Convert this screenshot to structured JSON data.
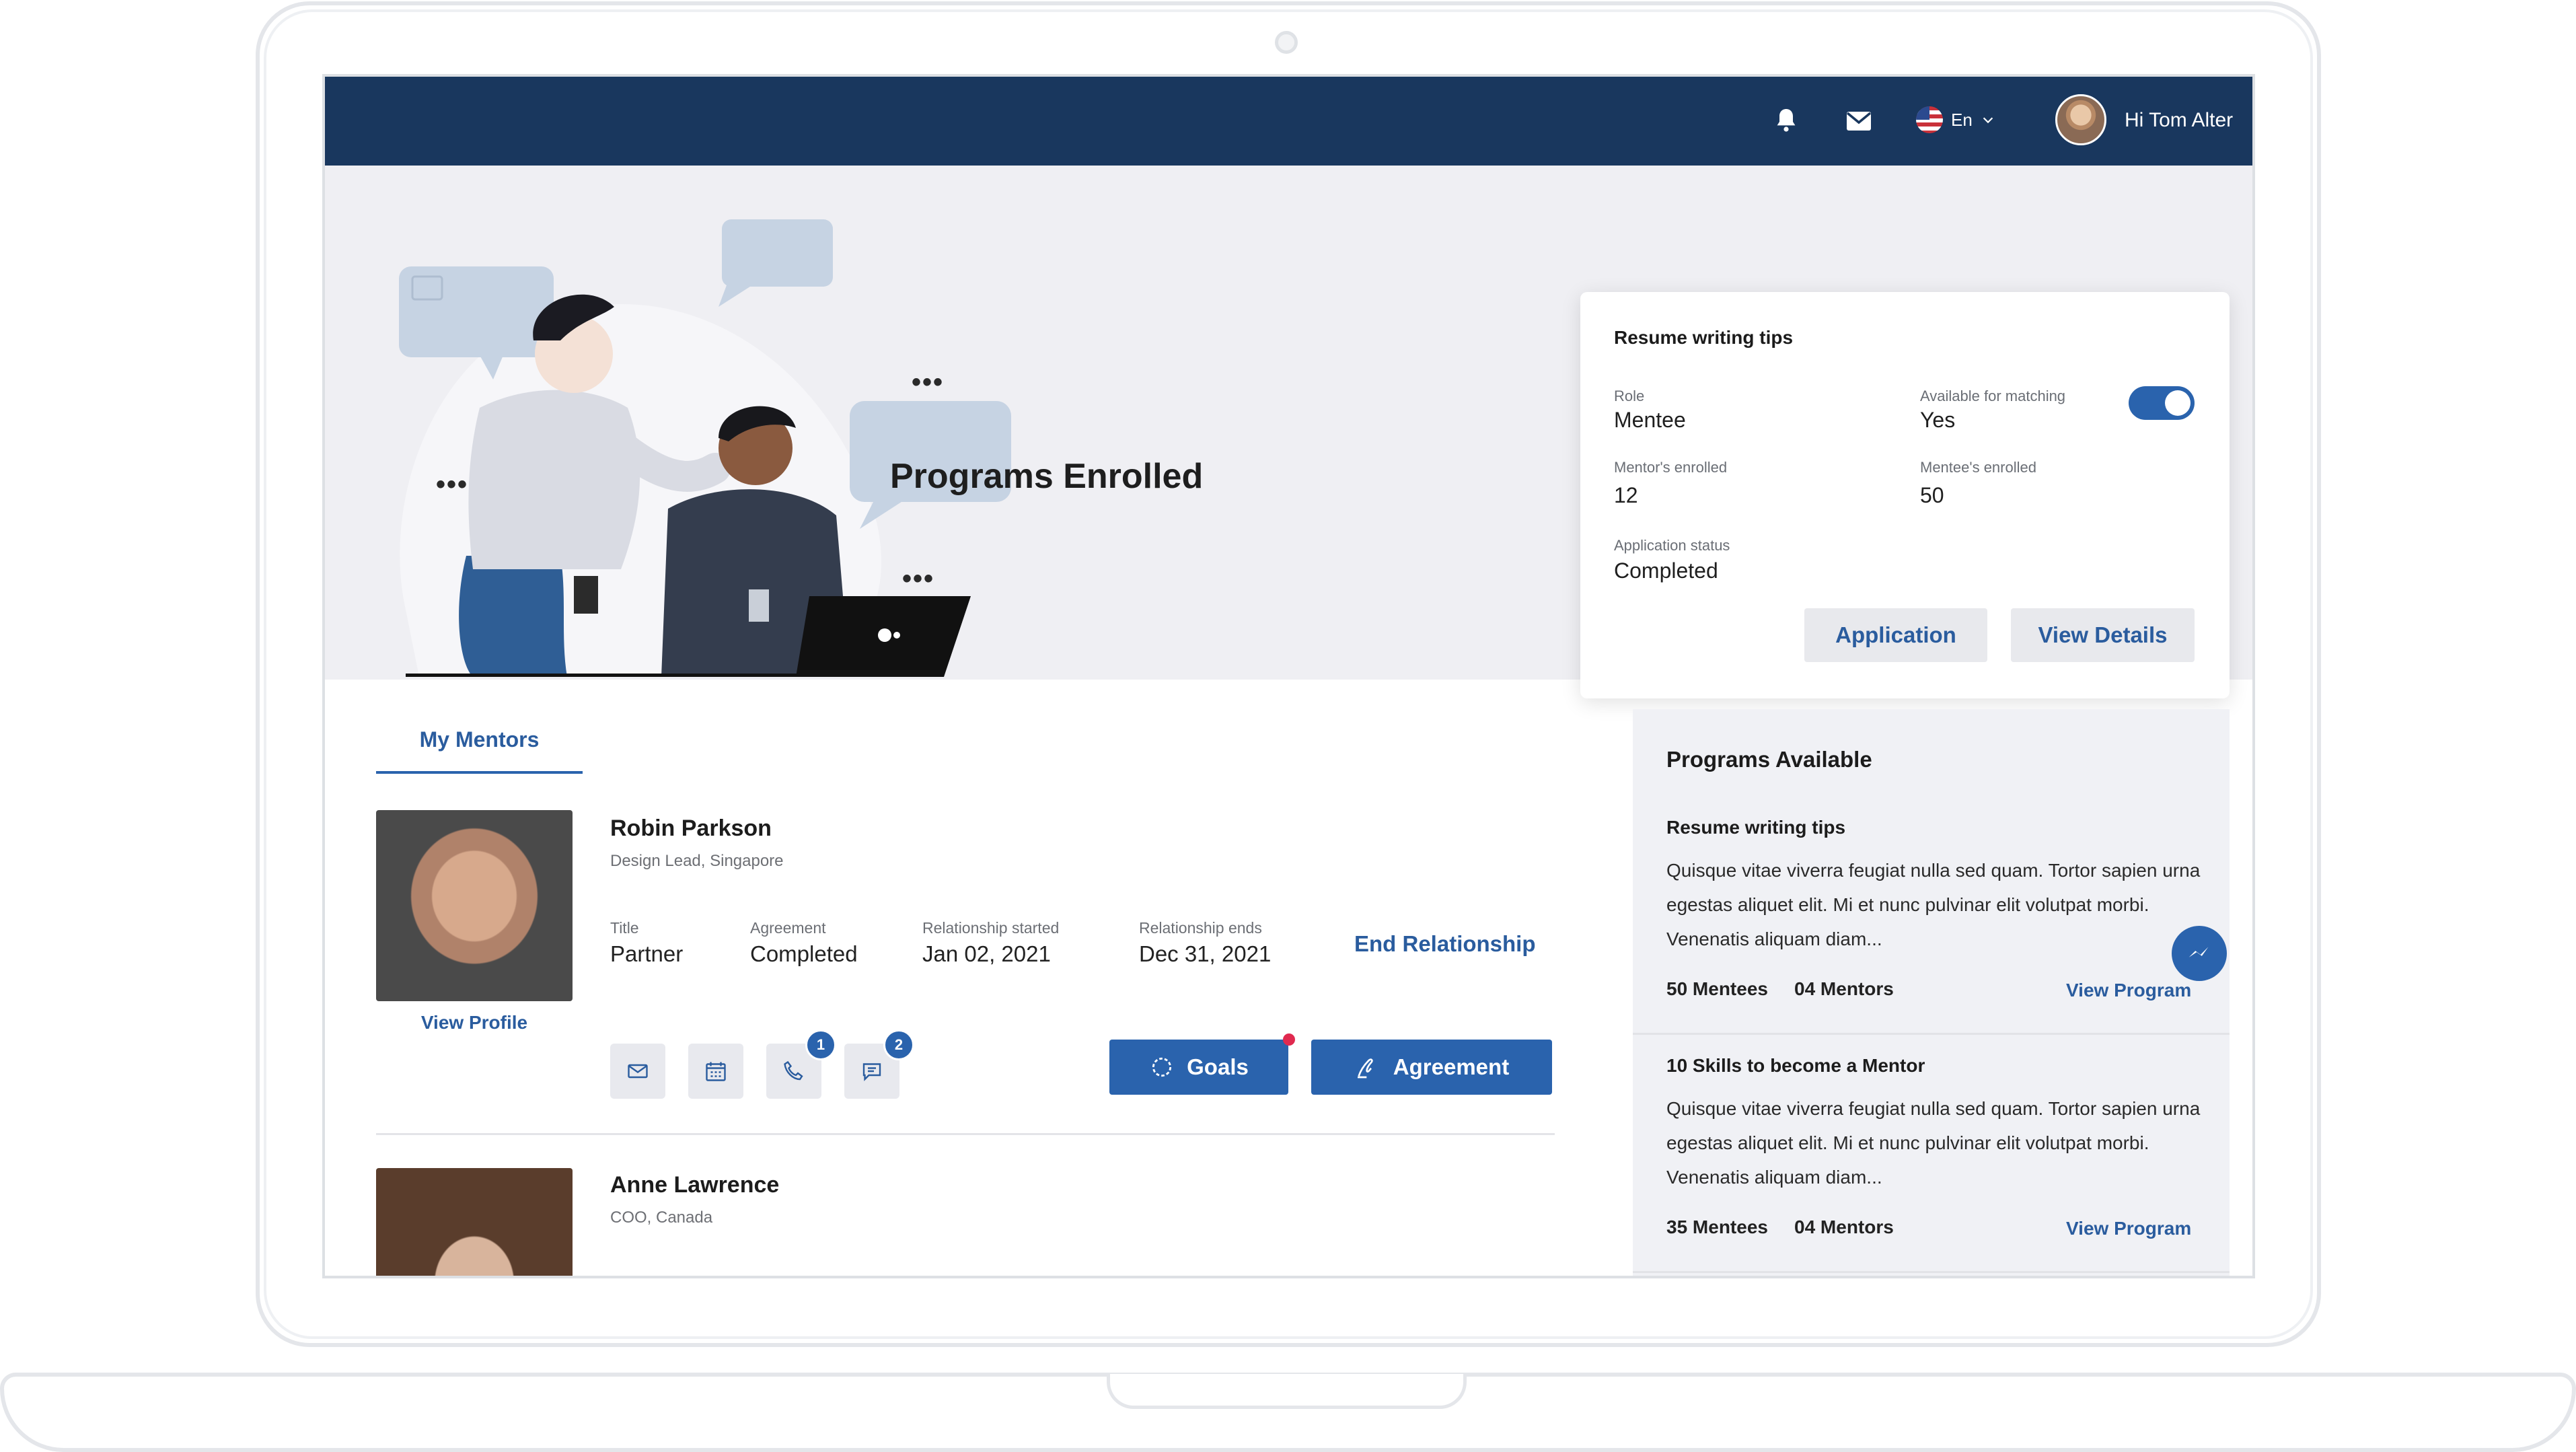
{
  "header": {
    "language": "En",
    "greeting": "Hi Tom Alter",
    "icons": [
      "bell-icon",
      "mail-icon",
      "us-flag-icon",
      "chevron-down-icon"
    ]
  },
  "hero": {
    "title": "Programs Enrolled"
  },
  "program_card": {
    "title": "Resume writing tips",
    "role_label": "Role",
    "role_value": "Mentee",
    "available_label": "Available for matching",
    "available_value": "Yes",
    "available_on": true,
    "mentors_label": "Mentor's enrolled",
    "mentors_value": "12",
    "mentees_label": "Mentee's enrolled",
    "mentees_value": "50",
    "status_label": "Application status",
    "status_value": "Completed",
    "application_button": "Application",
    "details_button": "View Details",
    "carousel_pages": 3,
    "carousel_active": 1
  },
  "mentors": {
    "tab_label": "My Mentors",
    "items": [
      {
        "name": "Robin Parkson",
        "subtitle": "Design Lead, Singapore",
        "view_profile": "View Profile",
        "title_label": "Title",
        "title_value": "Partner",
        "agreement_label": "Agreement",
        "agreement_value": "Completed",
        "started_label": "Relationship started",
        "started_value": "Jan 02, 2021",
        "ends_label": "Relationship ends",
        "ends_value": "Dec 31, 2021",
        "end_link": "End Relationship",
        "call_badge": "1",
        "chat_badge": "2",
        "goals_button": "Goals",
        "agreement_button": "Agreement"
      },
      {
        "name": "Anne Lawrence",
        "subtitle": "COO, Canada"
      }
    ]
  },
  "programs_available": {
    "title": "Programs Available",
    "items": [
      {
        "title": "Resume writing tips",
        "description": "Quisque vitae viverra feugiat nulla sed quam. Tortor sapien urna egestas aliquet elit. Mi et nunc pulvinar elit volutpat morbi. Venenatis aliquam diam...",
        "mentees": "50 Mentees",
        "mentors": "04 Mentors",
        "link": "View Program"
      },
      {
        "title": "10 Skills to become a Mentor",
        "description": "Quisque vitae viverra feugiat nulla sed quam. Tortor sapien urna egestas aliquet elit. Mi et nunc pulvinar elit volutpat morbi. Venenatis aliquam diam...",
        "mentees": "35 Mentees",
        "mentors": "04 Mentors",
        "link": "View Program"
      }
    ]
  },
  "colors": {
    "navy": "#19375e",
    "accent": "#2a63ad",
    "notification": "#e0294f"
  }
}
